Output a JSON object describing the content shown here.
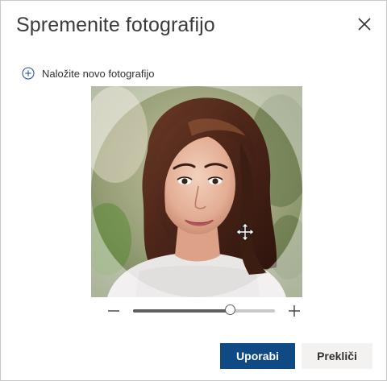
{
  "dialog": {
    "title": "Spremenite fotografijo",
    "close_icon": "close-icon"
  },
  "upload": {
    "icon": "add-circle-icon",
    "label": "Naložite novo fotografijo"
  },
  "photo": {
    "description_icon": "move-icon",
    "crop_shape": "circle"
  },
  "zoom": {
    "minus_icon": "zoom-out-icon",
    "plus_icon": "zoom-in-icon",
    "level_fraction": 0.68
  },
  "actions": {
    "apply_label": "Uporabi",
    "cancel_label": "Prekliči"
  },
  "colors": {
    "primary": "#0f4a85",
    "secondary_bg": "#f3f2f1",
    "text": "#323130"
  }
}
